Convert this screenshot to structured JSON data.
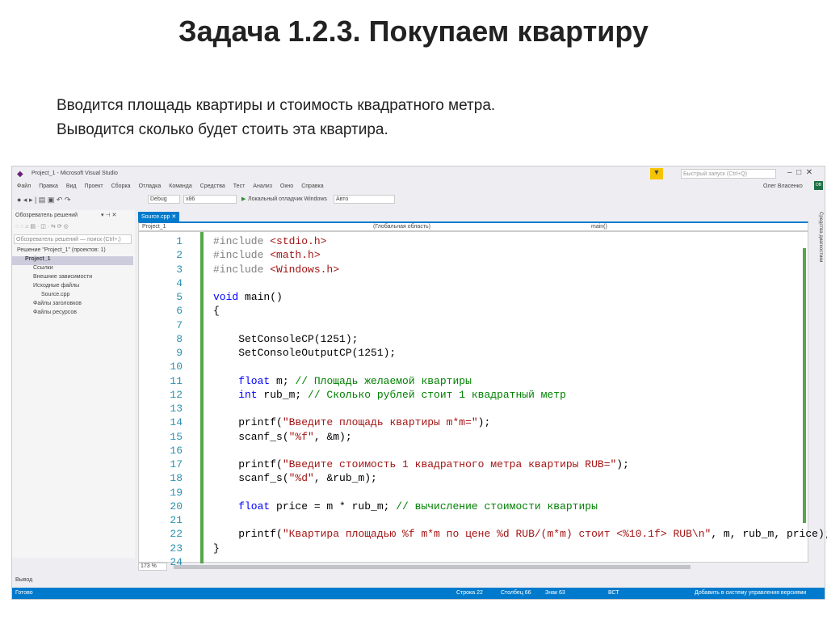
{
  "slide": {
    "title": "Задача 1.2.3. Покупаем квартиру",
    "lines": [
      "Вводится площадь квартиры и стоимость квадратного метра.",
      "Выводится сколько будет стоить эта квартира."
    ]
  },
  "vs": {
    "window_title": "Project_1 - Microsoft Visual Studio",
    "quick_launch": "Быстрый запуск (Ctrl+Q)",
    "user": "Олег Власенко",
    "user_initials": "ОВ",
    "menu": [
      "Файл",
      "Правка",
      "Вид",
      "Проект",
      "Сборка",
      "Отладка",
      "Команда",
      "Средства",
      "Тест",
      "Анализ",
      "Окно",
      "Справка"
    ],
    "config": "Debug",
    "platform": "x86",
    "run_label": "Локальный отладчик Windows",
    "run_mode": "Авто",
    "solution_explorer": {
      "title": "Обозреватель решений",
      "search": "Обозреватель решений — поиск (Ctrl+;)",
      "items": [
        {
          "label": "Решение \"Project_1\" (проектов: 1)",
          "level": 0
        },
        {
          "label": "Project_1",
          "level": 1
        },
        {
          "label": "Ссылки",
          "level": 2
        },
        {
          "label": "Внешние зависимости",
          "level": 2
        },
        {
          "label": "Исходные файлы",
          "level": 2
        },
        {
          "label": "Source.cpp",
          "level": 3
        },
        {
          "label": "Файлы заголовков",
          "level": 2
        },
        {
          "label": "Файлы ресурсов",
          "level": 2
        }
      ]
    },
    "tab": "Source.cpp",
    "nav_project": "Project_1",
    "nav_scope": "(Глобальная область)",
    "nav_member": "main()",
    "side_tab": "Средства диагностики",
    "zoom": "173 %",
    "output_label": "Вывод",
    "status": {
      "ready": "Готово",
      "line": "Строка 22",
      "col": "Столбец 66",
      "char": "Знак 63",
      "ins": "ВСТ",
      "vcs": "Добавить в систему управления версиями"
    },
    "code": [
      [
        [
          "pp",
          "#include "
        ],
        [
          "inc",
          "<stdio.h>"
        ]
      ],
      [
        [
          "pp",
          "#include "
        ],
        [
          "inc",
          "<math.h>"
        ]
      ],
      [
        [
          "pp",
          "#include "
        ],
        [
          "inc",
          "<Windows.h>"
        ]
      ],
      [],
      [
        [
          "kw",
          "void"
        ],
        [
          "fn",
          " main()"
        ]
      ],
      [
        [
          "fn",
          "{"
        ]
      ],
      [],
      [
        [
          "fn",
          "    SetConsoleCP(1251);"
        ]
      ],
      [
        [
          "fn",
          "    SetConsoleOutputCP(1251);"
        ]
      ],
      [],
      [
        [
          "kw",
          "    float"
        ],
        [
          "fn",
          " m; "
        ],
        [
          "cm",
          "// Площадь желаемой квартиры"
        ]
      ],
      [
        [
          "kw",
          "    int"
        ],
        [
          "fn",
          " rub_m; "
        ],
        [
          "cm",
          "// Сколько рублей стоит 1 квадратный метр"
        ]
      ],
      [],
      [
        [
          "fn",
          "    printf("
        ],
        [
          "str",
          "\"Введите площадь квартиры m*m=\""
        ],
        [
          "fn",
          ");"
        ]
      ],
      [
        [
          "fn",
          "    scanf_s("
        ],
        [
          "str",
          "\"%f\""
        ],
        [
          "fn",
          ", &m);"
        ]
      ],
      [],
      [
        [
          "fn",
          "    printf("
        ],
        [
          "str",
          "\"Введите стоимость 1 квадратного метра квартиры RUB=\""
        ],
        [
          "fn",
          ");"
        ]
      ],
      [
        [
          "fn",
          "    scanf_s("
        ],
        [
          "str",
          "\"%d\""
        ],
        [
          "fn",
          ", &rub_m);"
        ]
      ],
      [],
      [
        [
          "kw",
          "    float"
        ],
        [
          "fn",
          " price = m * rub_m; "
        ],
        [
          "cm",
          "// вычисление стоимости квартиры"
        ]
      ],
      [],
      [
        [
          "fn",
          "    printf("
        ],
        [
          "str",
          "\"Квартира площадью %f m*m по цене %d RUB/(m*m) стоит <%10.1f> RUB\\n\""
        ],
        [
          "fn",
          ", m, rub_m, price);"
        ]
      ],
      [
        [
          "fn",
          "}"
        ]
      ],
      []
    ]
  }
}
